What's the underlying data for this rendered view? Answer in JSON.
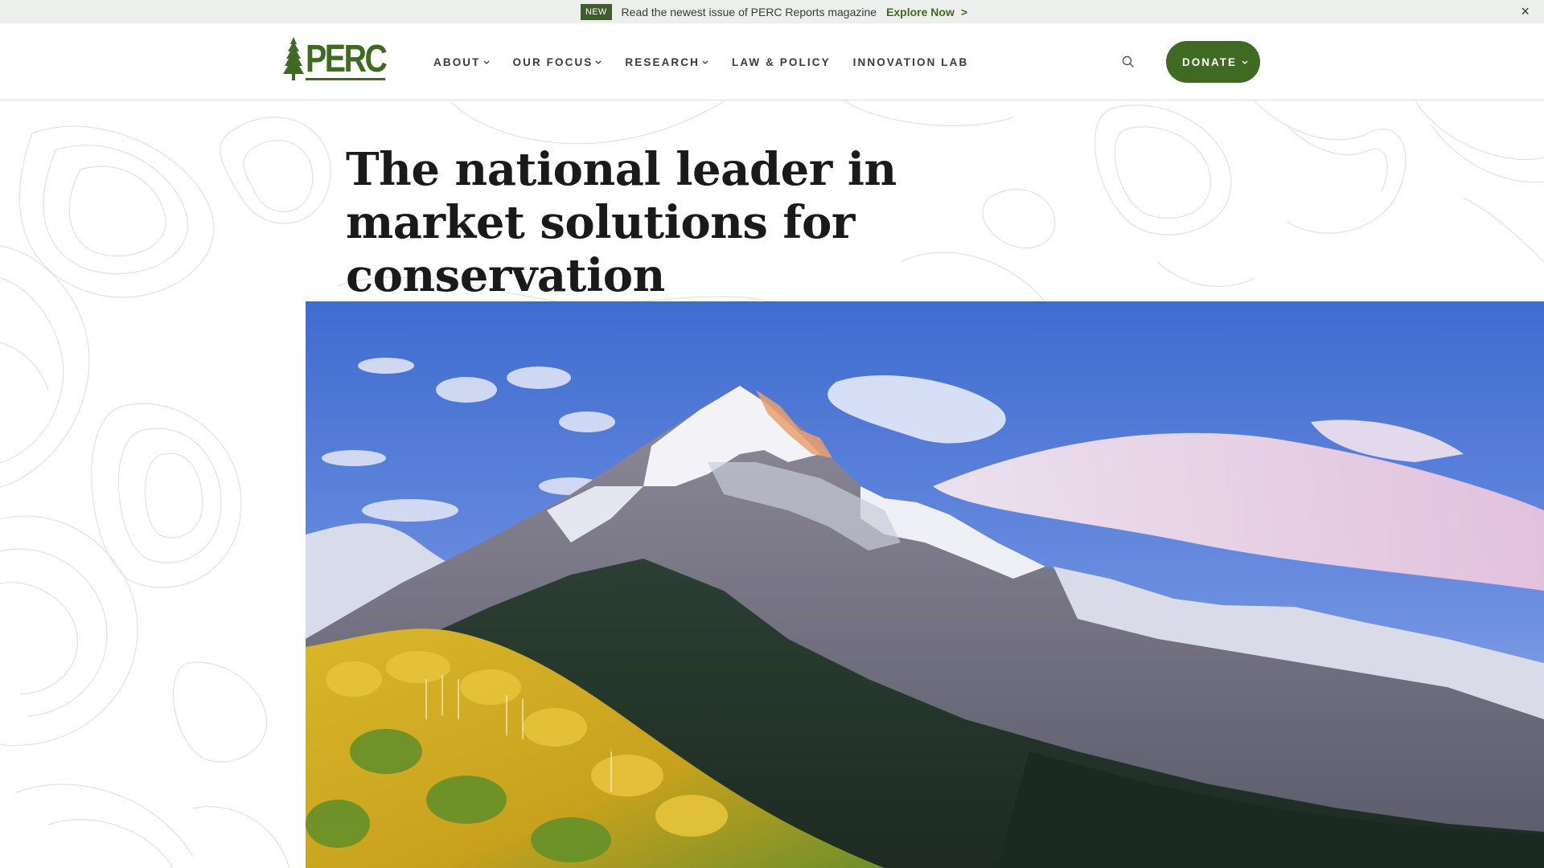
{
  "announcement": {
    "badge": "NEW",
    "text": "Read the newest issue of PERC Reports magazine",
    "link_label": "Explore Now",
    "arrow": ">",
    "close_glyph": "×"
  },
  "header": {
    "logo_text": "PERC",
    "logo_icon": "pine-tree-icon",
    "nav": [
      {
        "label": "ABOUT",
        "has_dropdown": true
      },
      {
        "label": "OUR FOCUS",
        "has_dropdown": true
      },
      {
        "label": "RESEARCH",
        "has_dropdown": true
      },
      {
        "label": "LAW & POLICY",
        "has_dropdown": false
      },
      {
        "label": "INNOVATION LAB",
        "has_dropdown": false
      }
    ],
    "search_icon": "search-icon",
    "donate_label": "DONATE"
  },
  "hero": {
    "title": "The national leader in market solutions for conservation",
    "image_icon": "mountain-landscape-image"
  },
  "colors": {
    "brand_green": "#3f6a22",
    "badge_green": "#3f5c2d",
    "announce_bg": "#edefec",
    "title_text": "#1a1a1a"
  }
}
